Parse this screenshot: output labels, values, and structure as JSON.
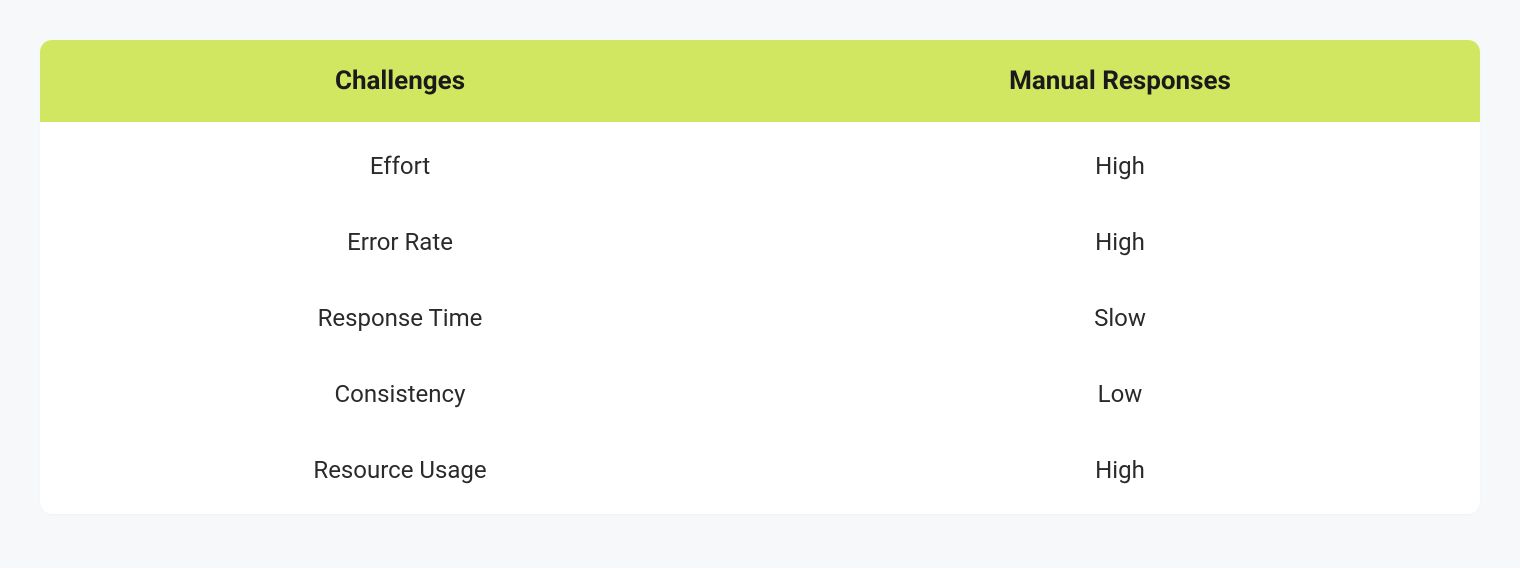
{
  "table": {
    "headers": {
      "col1": "Challenges",
      "col2": "Manual Responses"
    },
    "rows": [
      {
        "challenge": "Effort",
        "response": "High"
      },
      {
        "challenge": "Error Rate",
        "response": "High"
      },
      {
        "challenge": "Response Time",
        "response": "Slow"
      },
      {
        "challenge": "Consistency",
        "response": "Low"
      },
      {
        "challenge": "Resource Usage",
        "response": "High"
      }
    ]
  },
  "colors": {
    "header_bg": "#d2e761",
    "page_bg": "#f7f8fa",
    "table_bg": "#ffffff",
    "text": "#1a1a1a"
  },
  "chart_data": {
    "type": "table",
    "columns": [
      "Challenges",
      "Manual Responses"
    ],
    "data": [
      [
        "Effort",
        "High"
      ],
      [
        "Error Rate",
        "High"
      ],
      [
        "Response Time",
        "Slow"
      ],
      [
        "Consistency",
        "Low"
      ],
      [
        "Resource Usage",
        "High"
      ]
    ]
  }
}
